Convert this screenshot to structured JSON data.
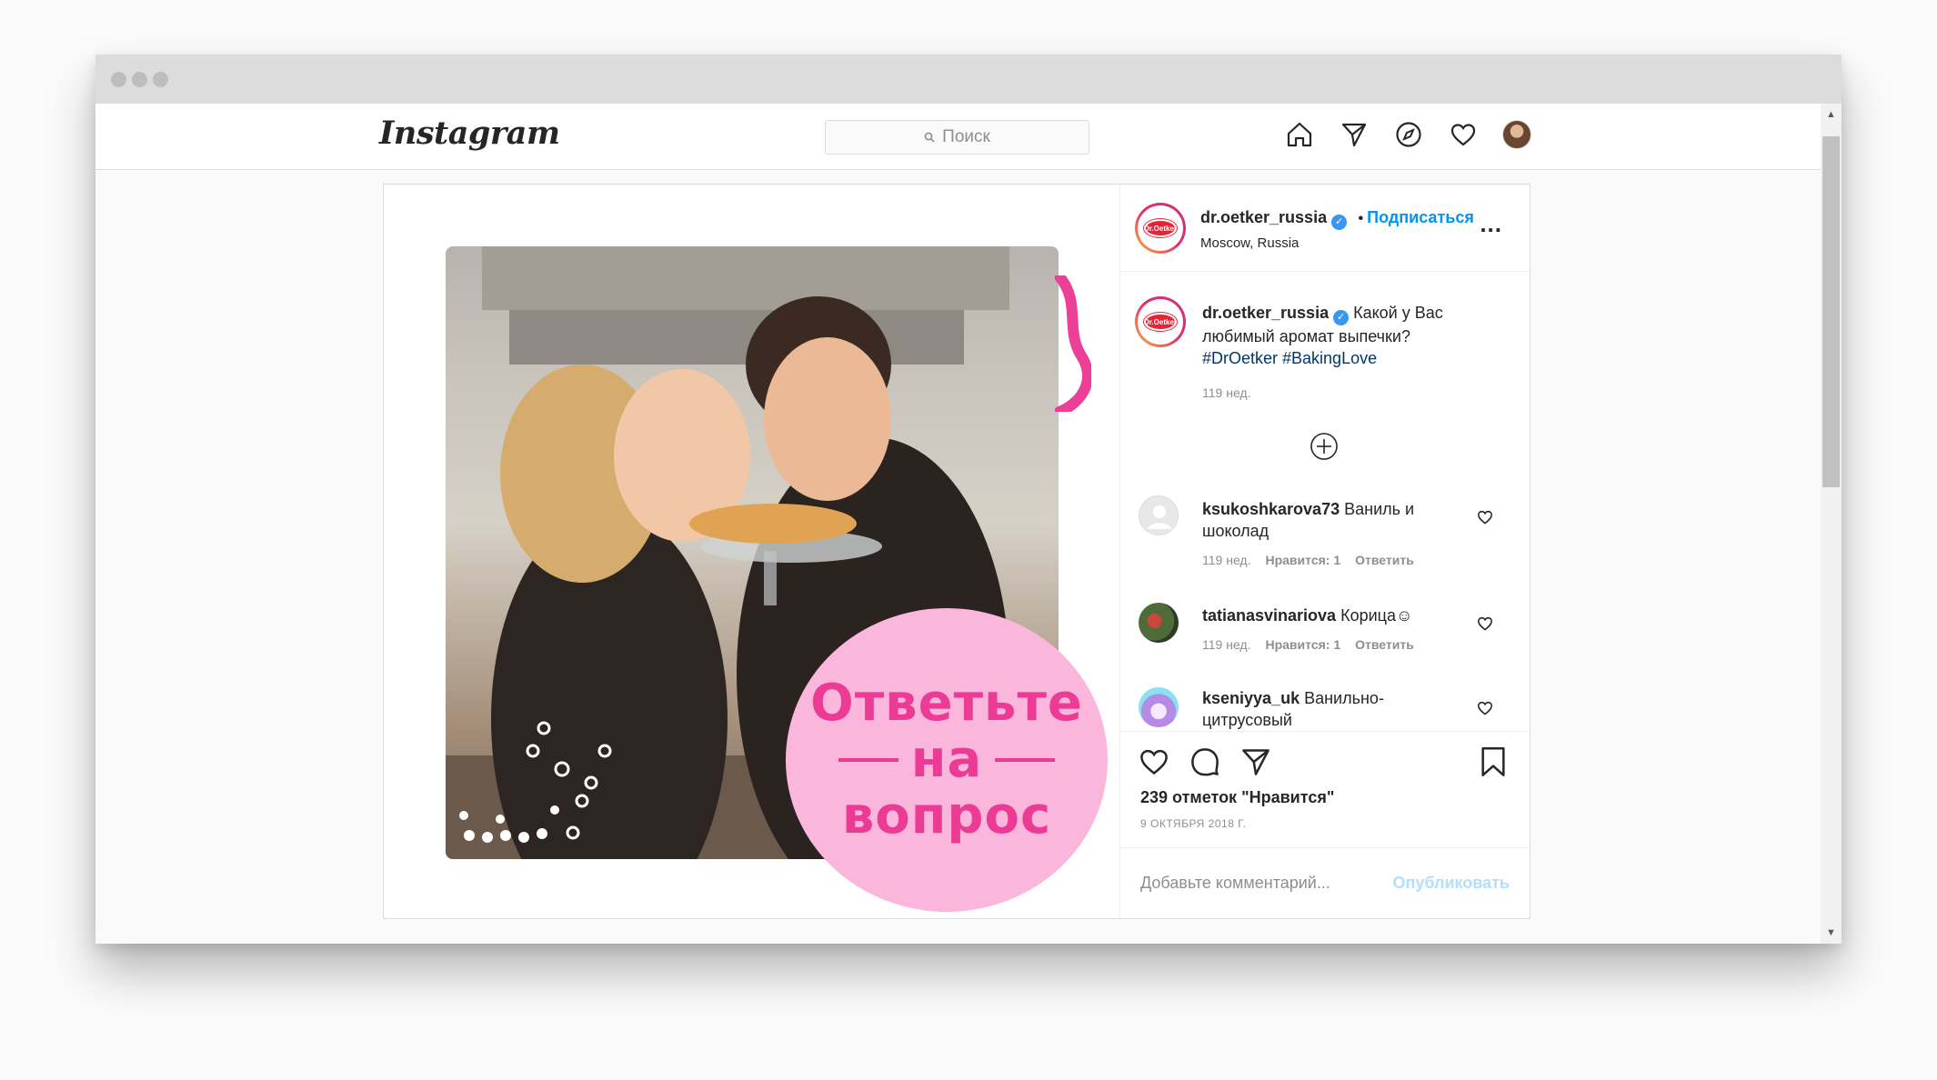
{
  "nav": {
    "logo": "Instagram",
    "search_placeholder": "Поиск"
  },
  "post": {
    "image_text": {
      "line1": "Ответьте",
      "line2": "на",
      "line3": "вопрос"
    },
    "header": {
      "username": "dr.oetker_russia",
      "follow": "Подписаться",
      "location": "Moscow, Russia",
      "avatar_logo": "Dr.Oetker"
    },
    "caption": {
      "username": "dr.oetker_russia",
      "text": "Какой у Вас любимый аромат выпечки?",
      "hashtags": "#DrOetker #BakingLove",
      "time": "119 нед."
    },
    "comments": [
      {
        "username": "ksukoshkarova73",
        "text": "Ваниль и шоколад",
        "time": "119 нед.",
        "likes": "Нравится: 1",
        "reply": "Ответить"
      },
      {
        "username": "tatianasvinariova",
        "text": "Корица☺",
        "time": "119 нед.",
        "likes": "Нравится: 1",
        "reply": "Ответить"
      },
      {
        "username": "kseniyya_uk",
        "text": "Ванильно-цитрусовый"
      }
    ],
    "likes_count": "239 отметок \"Нравится\"",
    "date": "9 ОКТЯБРЯ 2018 Г.",
    "add_comment_placeholder": "Добавьте комментарий...",
    "publish": "Опубликовать"
  },
  "colors": {
    "accent_blue": "#0095f6",
    "pink_circle": "#fbb6dc",
    "pink_text": "#ec3b95"
  }
}
